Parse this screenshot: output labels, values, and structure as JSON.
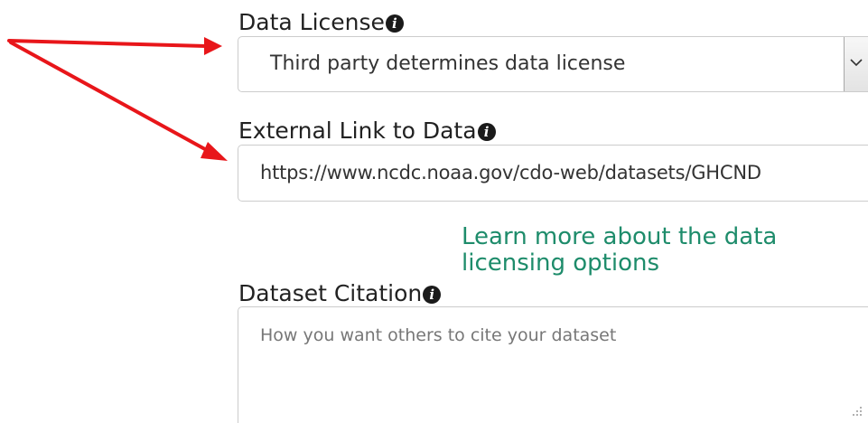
{
  "data_license": {
    "label": "Data License",
    "info_icon": "info-circle-icon",
    "selected_value": "Third party determines data license",
    "dropdown_icon": "chevron-down-icon"
  },
  "external_link": {
    "label": "External Link to Data",
    "info_icon": "info-circle-icon",
    "value": "https://www.ncdc.noaa.gov/cdo-web/datasets/GHCND"
  },
  "learn_more": {
    "text": "Learn more about the data licensing options",
    "color": "#1e8c6b"
  },
  "dataset_citation": {
    "label": "Dataset Citation",
    "info_icon": "info-circle-icon",
    "placeholder": "How you want others to cite your dataset",
    "value": ""
  },
  "annotation": {
    "arrow_color": "#e8161a",
    "arrow_icon": "red-arrow-icon"
  }
}
